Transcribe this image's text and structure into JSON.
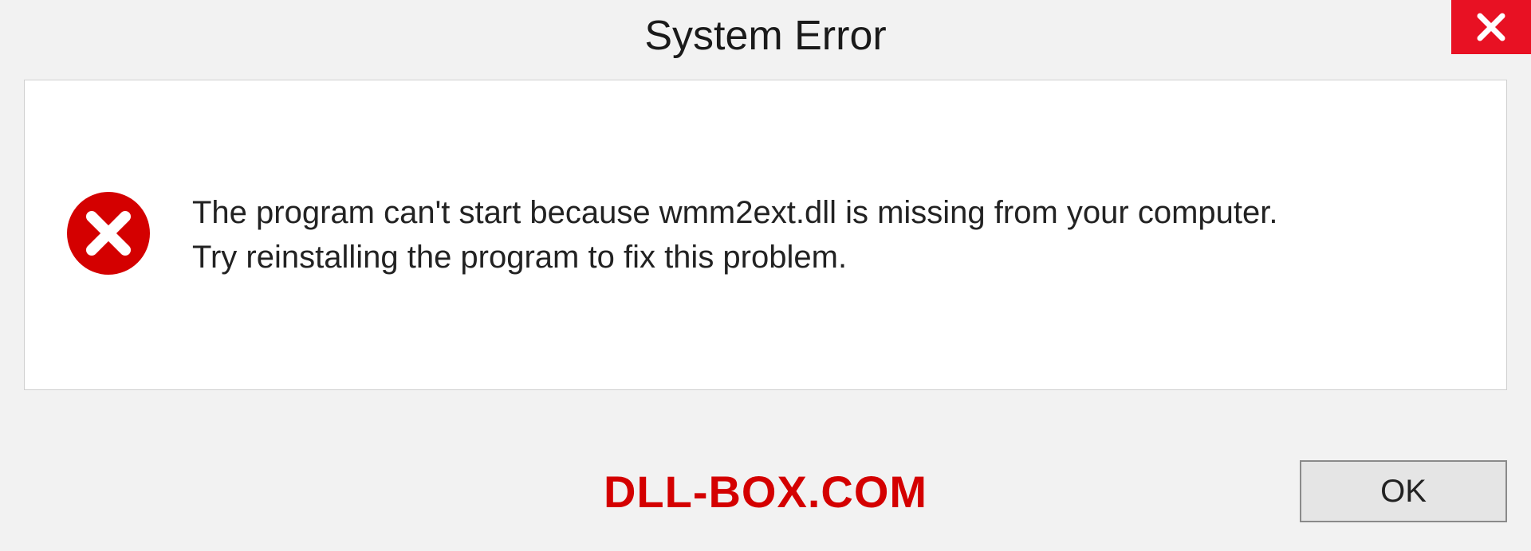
{
  "title": "System Error",
  "message": {
    "line1": "The program can't start because wmm2ext.dll is missing from your computer.",
    "line2": "Try reinstalling the program to fix this problem."
  },
  "brand": "DLL-BOX.COM",
  "ok_label": "OK",
  "colors": {
    "close_bg": "#e81123",
    "brand": "#d40000"
  }
}
